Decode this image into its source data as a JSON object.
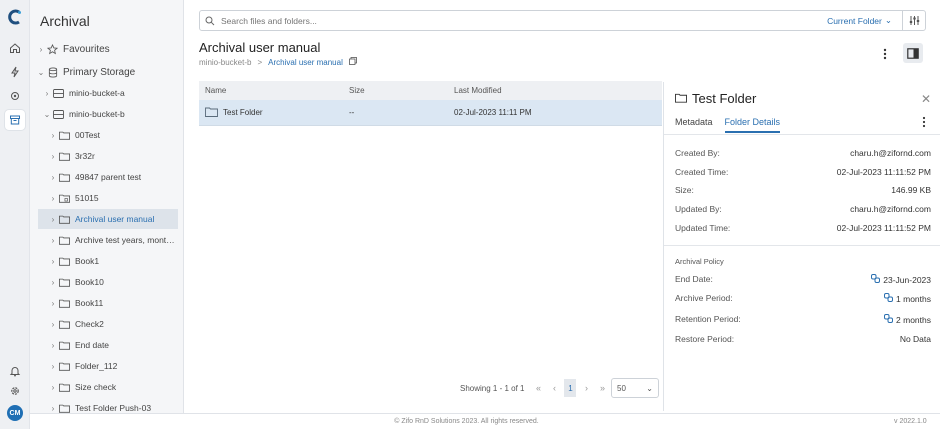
{
  "app": {
    "section_title": "Archival",
    "user_initials": "CM"
  },
  "tree": {
    "favourites": "Favourites",
    "primary_storage": "Primary Storage",
    "buckets": [
      "minio-bucket-a",
      "minio-bucket-b"
    ],
    "folders": [
      "00Test",
      "3r32r",
      "49847 parent test",
      "51015",
      "Archival user manual",
      "Archive test years, months...",
      "Book1",
      "Book10",
      "Book11",
      "Check2",
      "End date",
      "Folder_112",
      "Size check",
      "Test Folder Push-03"
    ]
  },
  "search": {
    "placeholder": "Search files and folders...",
    "scope": "Current Folder"
  },
  "page": {
    "title": "Archival user manual",
    "breadcrumb_root": "minio-bucket-b",
    "breadcrumb_current": "Archival user manual"
  },
  "table": {
    "headers": {
      "name": "Name",
      "size": "Size",
      "modified": "Last Modified"
    },
    "rows": [
      {
        "name": "Test Folder",
        "size": "--",
        "modified": "02-Jul-2023 11:11 PM"
      }
    ]
  },
  "pager": {
    "showing": "Showing 1 - 1 of 1",
    "page": "1",
    "page_size": "50"
  },
  "details": {
    "title": "Test Folder",
    "tabs": [
      "Metadata",
      "Folder Details"
    ],
    "fields": [
      {
        "label": "Created By:",
        "value": "charu.h@zifornd.com"
      },
      {
        "label": "Created Time:",
        "value": "02-Jul-2023 11:11:52 PM"
      },
      {
        "label": "Size:",
        "value": "146.99 KB"
      },
      {
        "label": "Updated By:",
        "value": "charu.h@zifornd.com"
      },
      {
        "label": "Updated Time:",
        "value": "02-Jul-2023 11:11:52 PM"
      }
    ],
    "policy_title": "Archival Policy",
    "policy": [
      {
        "label": "End Date:",
        "value": "23-Jun-2023"
      },
      {
        "label": "Archive Period:",
        "value": "1 months"
      },
      {
        "label": "Retention Period:",
        "value": "2 months"
      },
      {
        "label": "Restore Period:",
        "value": "No Data"
      }
    ]
  },
  "footer": {
    "copyright": "© Zifo RnD Solutions 2023. All rights reserved.",
    "version": "v 2022.1.0"
  },
  "colors": {
    "accent": "#2a6fb0",
    "selected_row": "#dbe7f3"
  }
}
